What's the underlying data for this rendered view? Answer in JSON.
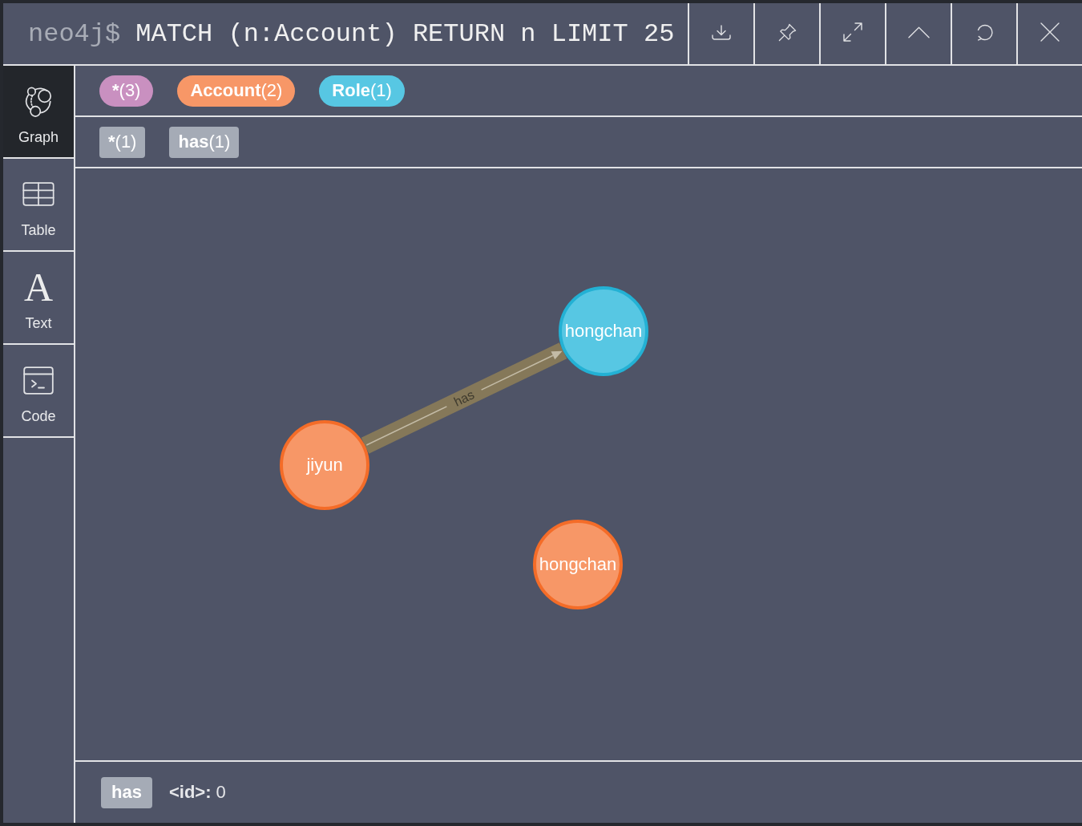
{
  "query_bar": {
    "prompt": "neo4j$",
    "query": "MATCH (n:Account) RETURN n LIMIT 25"
  },
  "sidebar": {
    "items": [
      {
        "kind": "icon",
        "label": "Graph",
        "selected": true
      },
      {
        "kind": "icon",
        "label": "Table",
        "selected": false
      },
      {
        "kind": "glyph",
        "glyph": "A",
        "label": "Text",
        "selected": false
      },
      {
        "kind": "icon",
        "label": "Code",
        "selected": false
      }
    ]
  },
  "node_labels": [
    {
      "name": "*",
      "count": "(3)",
      "color": "#c990c0"
    },
    {
      "name": "Account",
      "count": "(2)",
      "color": "#f79767"
    },
    {
      "name": "Role",
      "count": "(1)",
      "color": "#57c7e3"
    }
  ],
  "relationship_types": [
    {
      "name": "*",
      "count": "(1)"
    },
    {
      "name": "has",
      "count": "(1)"
    }
  ],
  "graph": {
    "nodes": [
      {
        "caption": "jiyun",
        "color": "#f79767"
      },
      {
        "caption": "hongchan",
        "color": "#57c7e3"
      },
      {
        "caption": "hongchan",
        "color": "#f79767"
      }
    ],
    "relationships": [
      {
        "type": "has",
        "selected": true
      }
    ]
  },
  "details": {
    "type": "has",
    "properties": [
      {
        "key": "<id>:",
        "value": "0"
      }
    ]
  }
}
